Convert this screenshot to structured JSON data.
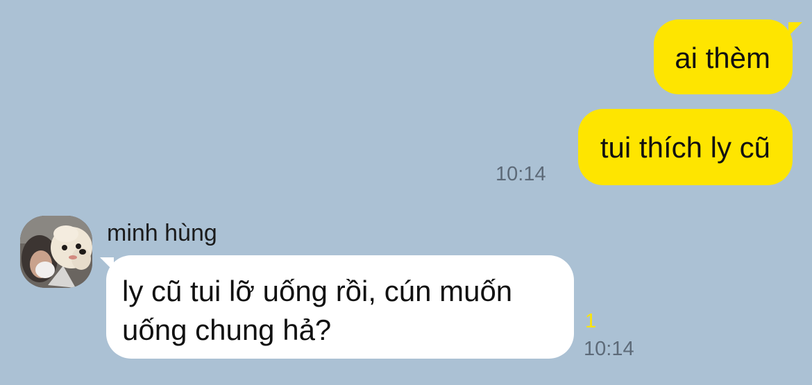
{
  "chat": {
    "outgoing": [
      {
        "text": "ai thèm"
      },
      {
        "text": "tui thích ly cũ"
      }
    ],
    "outgoing_time": "10:14",
    "incoming": {
      "sender": "minh hùng",
      "text": "ly cũ tui lỡ uống rồi, cún muốn uống chung hả?",
      "unread_count": "1",
      "time": "10:14"
    }
  },
  "colors": {
    "background": "#abc1d4",
    "outgoing_bubble": "#fee500",
    "incoming_bubble": "#ffffff",
    "unread": "#fee500"
  },
  "icons": {
    "avatar": "profile-photo"
  }
}
